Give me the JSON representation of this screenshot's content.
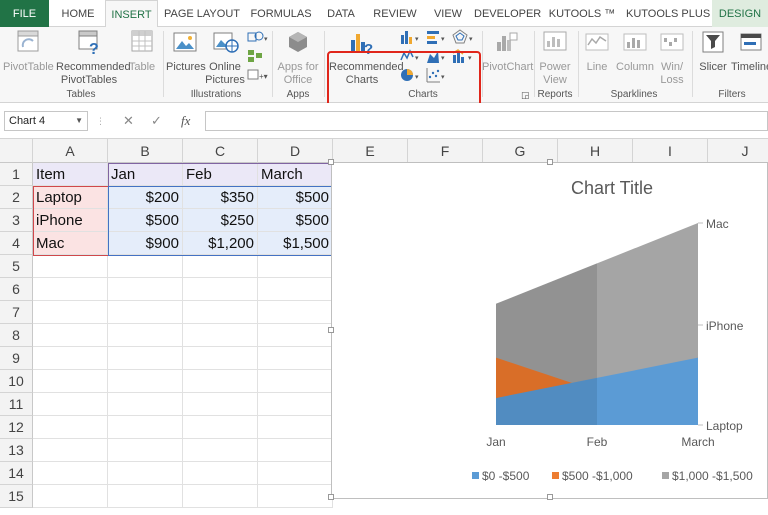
{
  "tabs": [
    "FILE",
    "HOME",
    "INSERT",
    "PAGE LAYOUT",
    "FORMULAS",
    "DATA",
    "REVIEW",
    "VIEW",
    "DEVELOPER",
    "KUTOOLS ™",
    "KUTOOLS PLUS",
    "DESIGN"
  ],
  "ribbon": {
    "pivottable": "PivotTable",
    "recommended_pivot_1": "Recommended",
    "recommended_pivot_2": "PivotTables",
    "table": "Table",
    "tables_group": "Tables",
    "pictures": "Pictures",
    "online_pictures_1": "Online",
    "online_pictures_2": "Pictures",
    "illustrations_group": "Illustrations",
    "apps_for_office_1": "Apps for",
    "apps_for_office_2": "Office",
    "apps_group": "Apps",
    "recommended_charts_1": "Recommended",
    "recommended_charts_2": "Charts",
    "charts_group": "Charts",
    "pivotchart": "PivotChart",
    "power_view_1": "Power",
    "power_view_2": "View",
    "reports_group": "Reports",
    "line": "Line",
    "column": "Column",
    "winloss_1": "Win/",
    "winloss_2": "Loss",
    "sparklines_group": "Sparklines",
    "slicer": "Slicer",
    "timeline": "Timeline",
    "filters_group": "Filters"
  },
  "formula_bar": {
    "name_box": "Chart 4",
    "cancel": "✕",
    "enter": "✓",
    "fx": "fx",
    "formula": ""
  },
  "columns": [
    "A",
    "B",
    "C",
    "D",
    "E",
    "F",
    "G",
    "H",
    "I",
    "J"
  ],
  "rows": [
    "1",
    "2",
    "3",
    "4",
    "5",
    "6",
    "7",
    "8",
    "9",
    "10",
    "11",
    "12",
    "13",
    "14",
    "15"
  ],
  "table": {
    "header": [
      "Item",
      "Jan",
      "Feb",
      "March"
    ],
    "rows": [
      [
        "Laptop",
        "$200",
        "$350",
        "$500"
      ],
      [
        "iPhone",
        "$500",
        "$250",
        "$500"
      ],
      [
        "Mac",
        "$900",
        "$1,200",
        "$1,500"
      ]
    ]
  },
  "colors": {
    "excel_green": "#217346",
    "series_blue": "#5b9bd5",
    "series_orange": "#ed7d31",
    "series_gray": "#a5a5a5",
    "highlight_red": "#e0261b"
  },
  "chart_data": {
    "type": "area",
    "title": "Chart Title",
    "categories": [
      "Jan",
      "Feb",
      "March"
    ],
    "depth_axis": [
      "Laptop",
      "iPhone",
      "Mac"
    ],
    "legend": [
      "$0 -$500",
      "$500 -$1,000",
      "$1,000 -$1,500"
    ],
    "legend_position": "bottom",
    "series": [
      {
        "name": "Laptop",
        "values": [
          200,
          350,
          500
        ]
      },
      {
        "name": "iPhone",
        "values": [
          500,
          250,
          500
        ]
      },
      {
        "name": "Mac",
        "values": [
          900,
          1200,
          1500
        ]
      }
    ]
  }
}
